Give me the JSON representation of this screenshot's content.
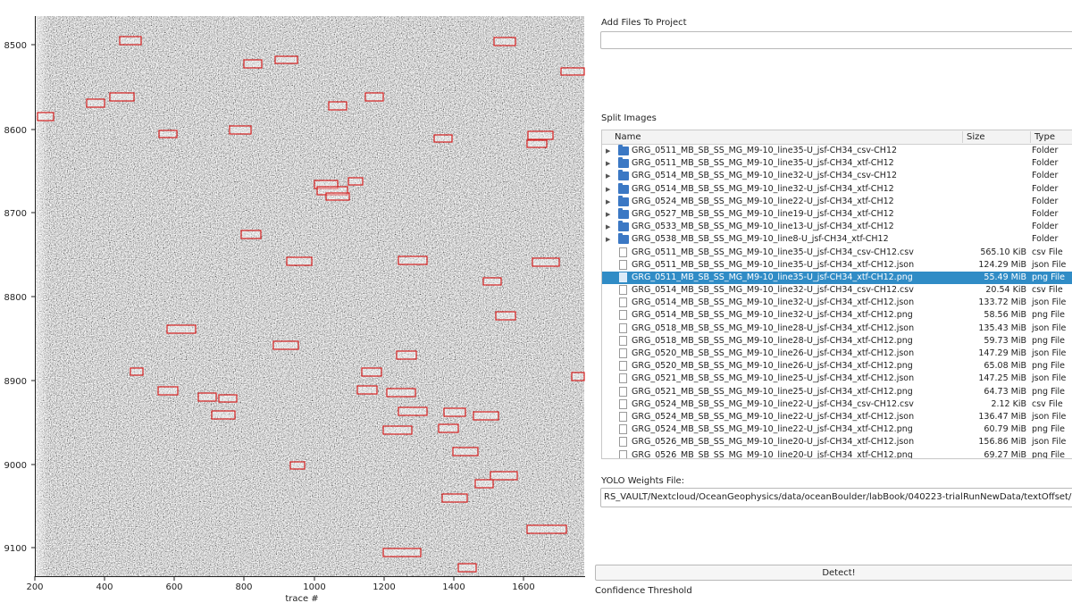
{
  "plot": {
    "y_ticks": [
      "8500",
      "8600",
      "8700",
      "8800",
      "8900",
      "9000",
      "9100"
    ],
    "x_ticks": [
      "200",
      "400",
      "600",
      "800",
      "1000",
      "1200",
      "1400",
      "1600"
    ],
    "xlabel": "trace #",
    "box_color": "#d42020"
  },
  "add_files": {
    "label": "Add Files To Project",
    "value": ""
  },
  "split_images": {
    "label": "Split Images",
    "columns": {
      "name": "Name",
      "size": "Size",
      "type": "Type"
    },
    "rows": [
      {
        "name": "GRG_0511_MB_SB_SS_MG_M9-10_line35-U_jsf-CH34_csv-CH12",
        "size": "",
        "type": "Folder",
        "kind": "folder"
      },
      {
        "name": "GRG_0511_MB_SB_SS_MG_M9-10_line35-U_jsf-CH34_xtf-CH12",
        "size": "",
        "type": "Folder",
        "kind": "folder"
      },
      {
        "name": "GRG_0514_MB_SB_SS_MG_M9-10_line32-U_jsf-CH34_csv-CH12",
        "size": "",
        "type": "Folder",
        "kind": "folder"
      },
      {
        "name": "GRG_0514_MB_SB_SS_MG_M9-10_line32-U_jsf-CH34_xtf-CH12",
        "size": "",
        "type": "Folder",
        "kind": "folder"
      },
      {
        "name": "GRG_0524_MB_SB_SS_MG_M9-10_line22-U_jsf-CH34_xtf-CH12",
        "size": "",
        "type": "Folder",
        "kind": "folder"
      },
      {
        "name": "GRG_0527_MB_SB_SS_MG_M9-10_line19-U_jsf-CH34_xtf-CH12",
        "size": "",
        "type": "Folder",
        "kind": "folder"
      },
      {
        "name": "GRG_0533_MB_SB_SS_MG_M9-10_line13-U_jsf-CH34_xtf-CH12",
        "size": "",
        "type": "Folder",
        "kind": "folder"
      },
      {
        "name": "GRG_0538_MB_SB_SS_MG_M9-10_line8-U_jsf-CH34_xtf-CH12",
        "size": "",
        "type": "Folder",
        "kind": "folder"
      },
      {
        "name": "GRG_0511_MB_SB_SS_MG_M9-10_line35-U_jsf-CH34_csv-CH12.csv",
        "size": "565.10 KiB",
        "type": "csv File",
        "kind": "file"
      },
      {
        "name": "GRG_0511_MB_SB_SS_MG_M9-10_line35-U_jsf-CH34_xtf-CH12.json",
        "size": "124.29 MiB",
        "type": "json File",
        "kind": "file"
      },
      {
        "name": "GRG_0511_MB_SB_SS_MG_M9-10_line35-U_jsf-CH34_xtf-CH12.png",
        "size": "55.49 MiB",
        "type": "png File",
        "kind": "file",
        "selected": true
      },
      {
        "name": "GRG_0514_MB_SB_SS_MG_M9-10_line32-U_jsf-CH34_csv-CH12.csv",
        "size": "20.54 KiB",
        "type": "csv File",
        "kind": "file"
      },
      {
        "name": "GRG_0514_MB_SB_SS_MG_M9-10_line32-U_jsf-CH34_xtf-CH12.json",
        "size": "133.72 MiB",
        "type": "json File",
        "kind": "file"
      },
      {
        "name": "GRG_0514_MB_SB_SS_MG_M9-10_line32-U_jsf-CH34_xtf-CH12.png",
        "size": "58.56 MiB",
        "type": "png File",
        "kind": "file"
      },
      {
        "name": "GRG_0518_MB_SB_SS_MG_M9-10_line28-U_jsf-CH34_xtf-CH12.json",
        "size": "135.43 MiB",
        "type": "json File",
        "kind": "file"
      },
      {
        "name": "GRG_0518_MB_SB_SS_MG_M9-10_line28-U_jsf-CH34_xtf-CH12.png",
        "size": "59.73 MiB",
        "type": "png File",
        "kind": "file"
      },
      {
        "name": "GRG_0520_MB_SB_SS_MG_M9-10_line26-U_jsf-CH34_xtf-CH12.json",
        "size": "147.29 MiB",
        "type": "json File",
        "kind": "file"
      },
      {
        "name": "GRG_0520_MB_SB_SS_MG_M9-10_line26-U_jsf-CH34_xtf-CH12.png",
        "size": "65.08 MiB",
        "type": "png File",
        "kind": "file"
      },
      {
        "name": "GRG_0521_MB_SB_SS_MG_M9-10_line25-U_jsf-CH34_xtf-CH12.json",
        "size": "147.25 MiB",
        "type": "json File",
        "kind": "file"
      },
      {
        "name": "GRG_0521_MB_SB_SS_MG_M9-10_line25-U_jsf-CH34_xtf-CH12.png",
        "size": "64.73 MiB",
        "type": "png File",
        "kind": "file"
      },
      {
        "name": "GRG_0524_MB_SB_SS_MG_M9-10_line22-U_jsf-CH34_csv-CH12.csv",
        "size": "2.12 KiB",
        "type": "csv File",
        "kind": "file"
      },
      {
        "name": "GRG_0524_MB_SB_SS_MG_M9-10_line22-U_jsf-CH34_xtf-CH12.json",
        "size": "136.47 MiB",
        "type": "json File",
        "kind": "file"
      },
      {
        "name": "GRG_0524_MB_SB_SS_MG_M9-10_line22-U_jsf-CH34_xtf-CH12.png",
        "size": "60.79 MiB",
        "type": "png File",
        "kind": "file"
      },
      {
        "name": "GRG_0526_MB_SB_SS_MG_M9-10_line20-U_jsf-CH34_xtf-CH12.json",
        "size": "156.86 MiB",
        "type": "json File",
        "kind": "file"
      },
      {
        "name": "GRG_0526_MB_SB_SS_MG_M9-10_line20-U_jsf-CH34_xtf-CH12.png",
        "size": "69.27 MiB",
        "type": "png File",
        "kind": "file"
      }
    ]
  },
  "yolo": {
    "label": "YOLO Weights File:",
    "value": "RS_VAULT/Nextcloud/OceanGeophysics/data/oceanBoulder/labBook/040223-trialRunNewData/textOffset/checkpoints/oceanA"
  },
  "detect_label": "Detect!",
  "confidence_label": "Confidence Threshold",
  "colors": {
    "selection": "#308cc6",
    "folder": "#3b78c4"
  }
}
